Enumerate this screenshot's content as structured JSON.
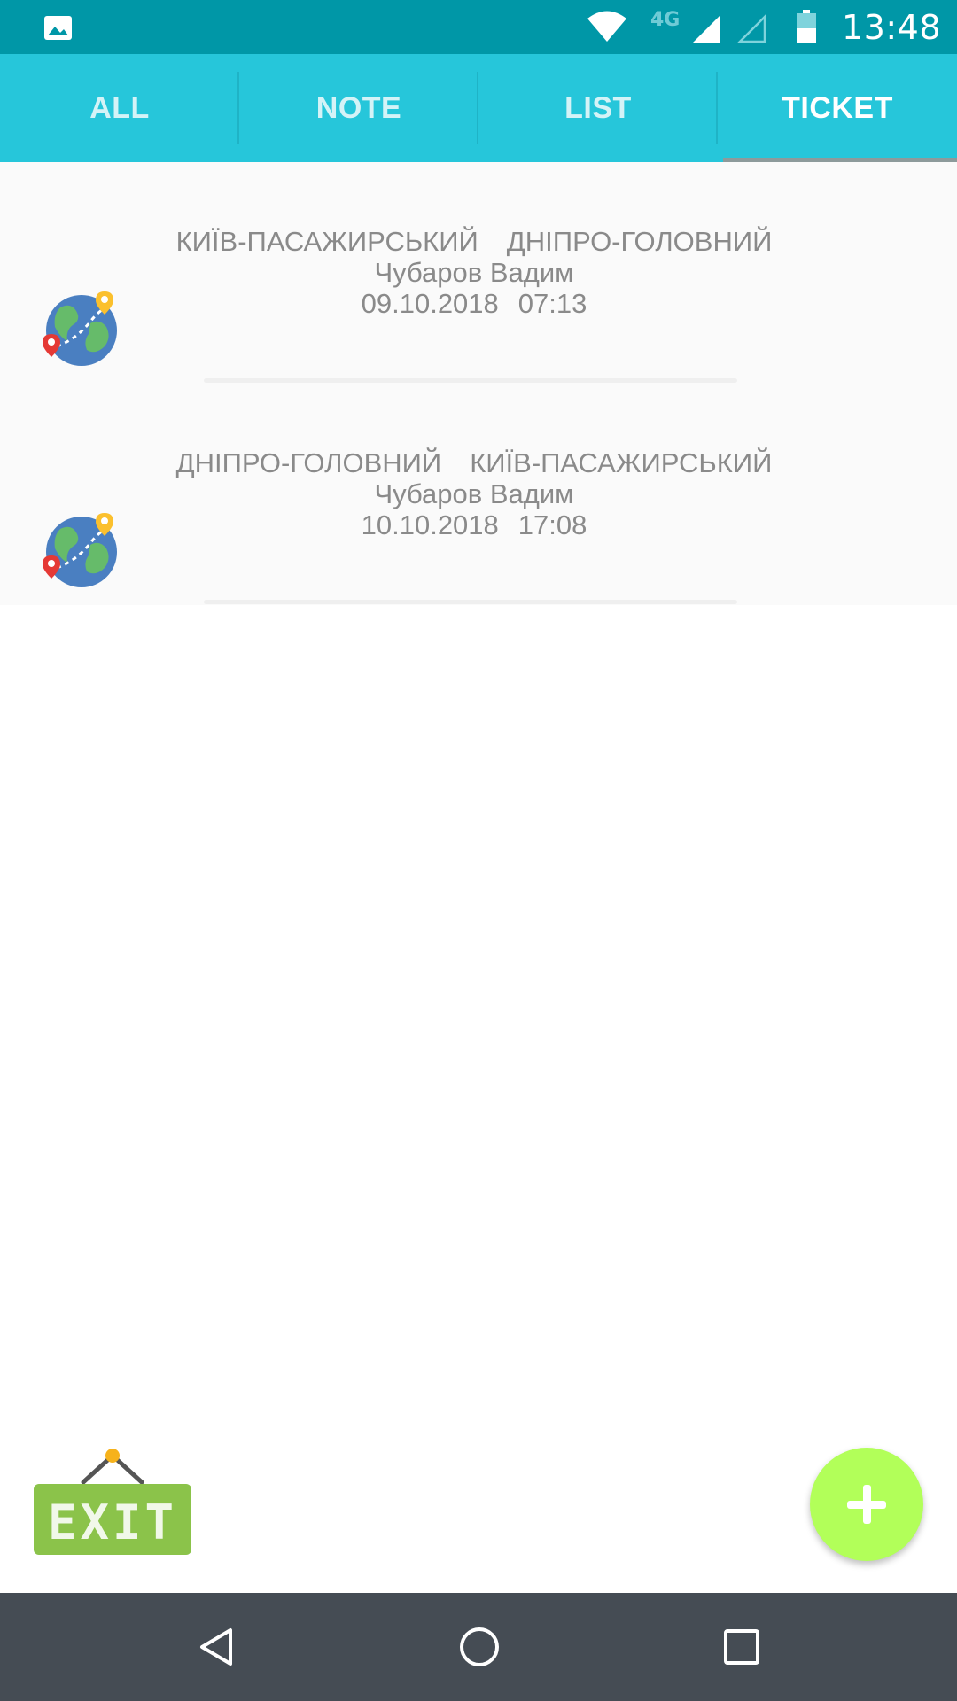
{
  "status_bar": {
    "time": "13:48",
    "network": "4G",
    "icons": [
      "gallery-icon",
      "wifi-icon",
      "signal-icon",
      "signal-empty-icon",
      "battery-icon"
    ],
    "background": "#0097a7"
  },
  "tabs": [
    {
      "label": "ALL",
      "active": false
    },
    {
      "label": "NOTE",
      "active": false
    },
    {
      "label": "LIST",
      "active": false
    },
    {
      "label": "TICKET",
      "active": true
    }
  ],
  "tickets": [
    {
      "from": "КИЇВ-ПАСАЖИРСЬКИЙ",
      "to": "ДНІПРО-ГОЛОВНИЙ",
      "passenger": "Чубаров Вадим",
      "date": "09.10.2018",
      "time": "07:13",
      "icon": "globe-route-icon"
    },
    {
      "from": "ДНІПРО-ГОЛОВНИЙ",
      "to": "КИЇВ-ПАСАЖИРСЬКИЙ",
      "passenger": "Чубаров Вадим",
      "date": "10.10.2018",
      "time": "17:08",
      "icon": "globe-route-icon"
    }
  ],
  "exit_button": {
    "label": "EXIT",
    "icon": "exit-sign-icon",
    "color": "#8bc34a"
  },
  "fab": {
    "icon": "plus-icon",
    "color": "#b2ff59"
  },
  "nav_bar": {
    "icons": [
      "back-icon",
      "home-icon",
      "recents-icon"
    ],
    "background": "#454c54"
  },
  "colors": {
    "tab_bar": "#26c6da",
    "text_gray": "#8a8a8a"
  }
}
